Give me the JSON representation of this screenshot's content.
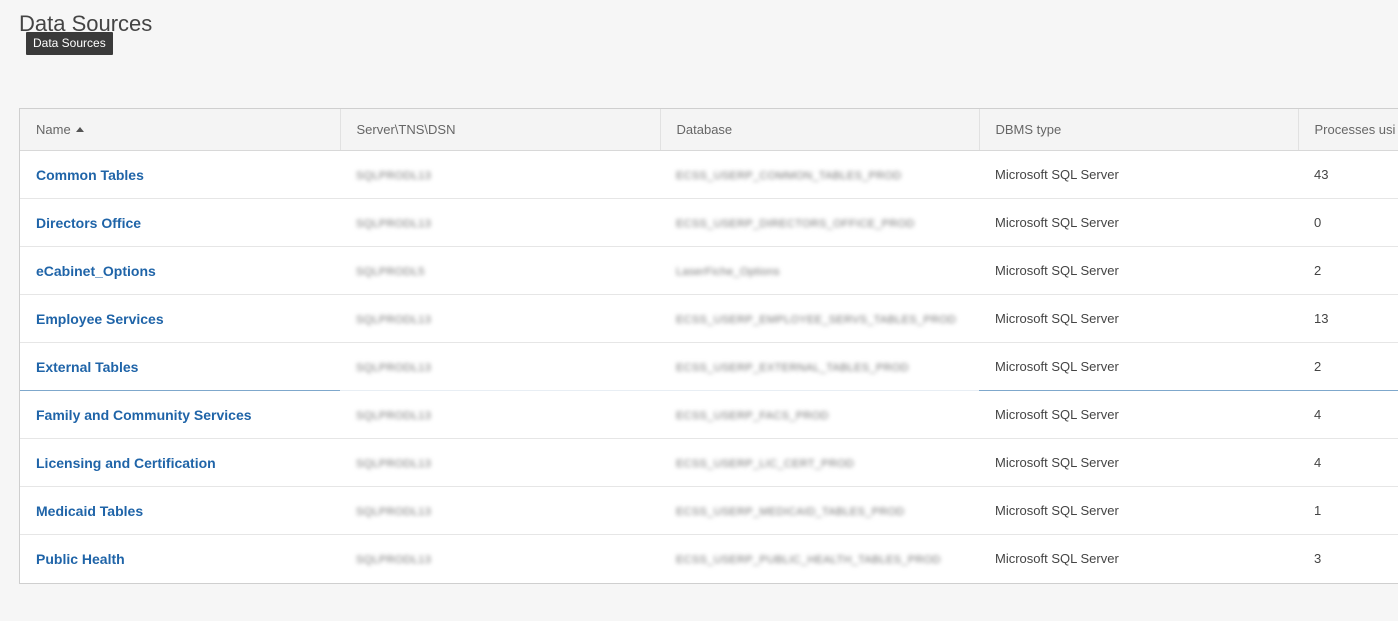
{
  "page": {
    "title": "Data Sources",
    "tooltip": "Data Sources"
  },
  "table": {
    "columns": {
      "name": "Name",
      "server": "Server\\TNS\\DSN",
      "database": "Database",
      "dbms": "DBMS type",
      "processes": "Processes usi"
    },
    "rows": [
      {
        "name": "Common Tables",
        "server": "SQLPRODL13",
        "database": "ECSS_USERP_COMMON_TABLES_PROD",
        "dbms": "Microsoft SQL Server",
        "processes": "43"
      },
      {
        "name": "Directors Office",
        "server": "SQLPRODL13",
        "database": "ECSS_USERP_DIRECTORS_OFFICE_PROD",
        "dbms": "Microsoft SQL Server",
        "processes": "0"
      },
      {
        "name": "eCabinet_Options",
        "server": "SQLPRODL5",
        "database": "LaserFiche_Options",
        "dbms": "Microsoft SQL Server",
        "processes": "2"
      },
      {
        "name": "Employee Services",
        "server": "SQLPRODL13",
        "database": "ECSS_USERP_EMPLOYEE_SERVS_TABLES_PROD",
        "dbms": "Microsoft SQL Server",
        "processes": "13"
      },
      {
        "name": "External Tables",
        "server": "SQLPRODL13",
        "database": "ECSS_USERP_EXTERNAL_TABLES_PROD",
        "dbms": "Microsoft SQL Server",
        "processes": "2"
      },
      {
        "name": "Family and Community Services",
        "server": "SQLPRODL13",
        "database": "ECSS_USERP_FACS_PROD",
        "dbms": "Microsoft SQL Server",
        "processes": "4"
      },
      {
        "name": "Licensing and Certification",
        "server": "SQLPRODL13",
        "database": "ECSS_USERP_LIC_CERT_PROD",
        "dbms": "Microsoft SQL Server",
        "processes": "4"
      },
      {
        "name": "Medicaid Tables",
        "server": "SQLPRODL13",
        "database": "ECSS_USERP_MEDICAID_TABLES_PROD",
        "dbms": "Microsoft SQL Server",
        "processes": "1"
      },
      {
        "name": "Public Health",
        "server": "SQLPRODL13",
        "database": "ECSS_USERP_PUBLIC_HEALTH_TABLES_PROD",
        "dbms": "Microsoft SQL Server",
        "processes": "3"
      }
    ]
  }
}
